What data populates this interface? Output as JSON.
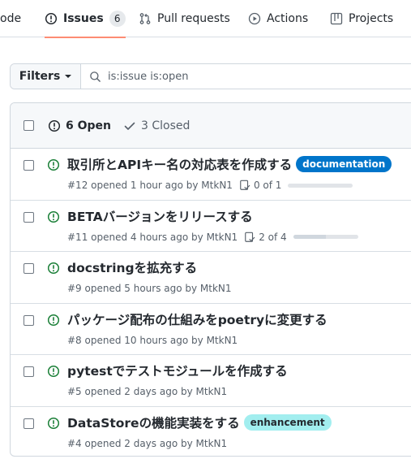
{
  "tabs": [
    {
      "label": "ode",
      "icon": "code-icon"
    },
    {
      "label": "Issues",
      "icon": "issue-opened-icon",
      "counter": "6",
      "active": true
    },
    {
      "label": "Pull requests",
      "icon": "git-pull-request-icon"
    },
    {
      "label": "Actions",
      "icon": "play-icon"
    },
    {
      "label": "Projects",
      "icon": "table-icon"
    }
  ],
  "filter": {
    "button_label": "Filters",
    "search_value": "is:issue is:open"
  },
  "header": {
    "open_label": "6 Open",
    "closed_label": "3 Closed"
  },
  "issues": [
    {
      "title": "取引所とAPIキー名の対応表を作成する",
      "meta": "#12 opened 1 hour ago by MtkN1",
      "label": "documentation",
      "label_bg": "#0075ca",
      "label_fg": "#ffffff",
      "tasks": "0 of 1",
      "progress": 0
    },
    {
      "title": "BETAバージョンをリリースする",
      "meta": "#11 opened 4 hours ago by MtkN1",
      "tasks": "2 of 4",
      "progress": 0.5
    },
    {
      "title": "docstringを拡充する",
      "meta": "#9 opened 5 hours ago by MtkN1"
    },
    {
      "title": "パッケージ配布の仕組みをpoetryに変更する",
      "meta": "#8 opened 10 hours ago by MtkN1"
    },
    {
      "title": "pytestでテストモジュールを作成する",
      "meta": "#5 opened 2 days ago by MtkN1"
    },
    {
      "title": "DataStoreの機能実装をする",
      "meta": "#4 opened 2 days ago by MtkN1",
      "label": "enhancement",
      "label_bg": "#a2eeef",
      "label_fg": "#24292f"
    }
  ],
  "colors": {
    "open_green": "#1a7f37",
    "tab_underline": "#fd8c73"
  }
}
